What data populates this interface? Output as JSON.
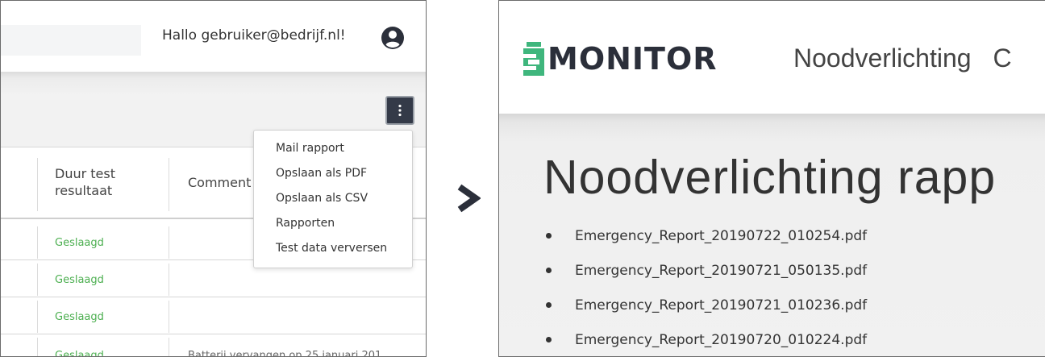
{
  "left": {
    "greeting": "Hallo gebruiker@bedrijf.nl!",
    "user_icon": "user-circle-icon",
    "menu_icon": "kebab-vertical-icon",
    "columns": [
      "Duur test resultaat",
      "Comment"
    ],
    "column_lines": {
      "col1_line1": "Duur test",
      "col1_line2": "resultaat",
      "col2": "Comment"
    },
    "rows": [
      {
        "result": "Geslaagd",
        "comment": ""
      },
      {
        "result": "Geslaagd",
        "comment": ""
      },
      {
        "result": "Geslaagd",
        "comment": ""
      },
      {
        "result": "Geslaagd",
        "comment": "Batterij vervangen op 25 januari 201"
      }
    ],
    "dropdown": {
      "items": [
        "Mail rapport",
        "Opslaan als PDF",
        "Opslaan als CSV",
        "Rapporten",
        "Test data verversen"
      ]
    },
    "colors": {
      "success": "#4caf50",
      "button": "#343a48"
    }
  },
  "arrow_icon": "chevron-right-icon",
  "right": {
    "logo_text": "MONITOR",
    "logo_mark": "E",
    "nav_item": "Noodverlichting",
    "nav_item_cut": "C",
    "title": "Noodverlichting rapp",
    "files": [
      "Emergency_Report_20190722_010254.pdf",
      "Emergency_Report_20190721_050135.pdf",
      "Emergency_Report_20190721_010236.pdf",
      "Emergency_Report_20190720_010224.pdf"
    ],
    "colors": {
      "logo_green": "#3fb67d",
      "logo_dark": "#2b2f3a"
    }
  }
}
